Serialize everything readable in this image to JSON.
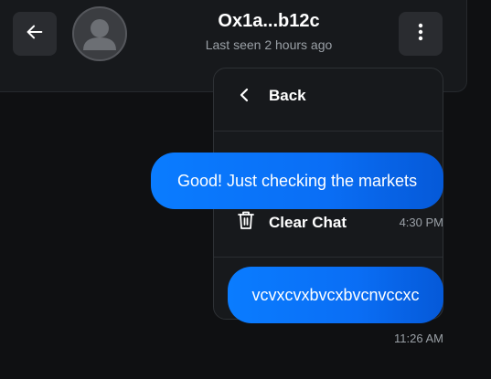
{
  "header": {
    "contact_name": "Ox1a...b12c",
    "status": "Last seen 2 hours ago",
    "back_icon": "arrow-left-icon",
    "menu_icon": "more-vertical-icon",
    "avatar_icon": "user-placeholder-icon"
  },
  "menu": {
    "back_label": "Back",
    "clear_label": "Clear Chat",
    "back_icon": "chevron-left-icon",
    "clear_icon": "trash-icon"
  },
  "messages": [
    {
      "text": "Good! Just checking the markets",
      "time": "4:30 PM",
      "direction": "outgoing"
    },
    {
      "text": "vcvxcvxbvcxbvcnvccxc",
      "time": "11:26 AM",
      "direction": "outgoing"
    }
  ],
  "colors": {
    "background": "#0f1012",
    "header": "#17191c",
    "bubble_start": "#0a7cff",
    "bubble_end": "#0559d8",
    "muted_text": "#9aa0a6"
  }
}
